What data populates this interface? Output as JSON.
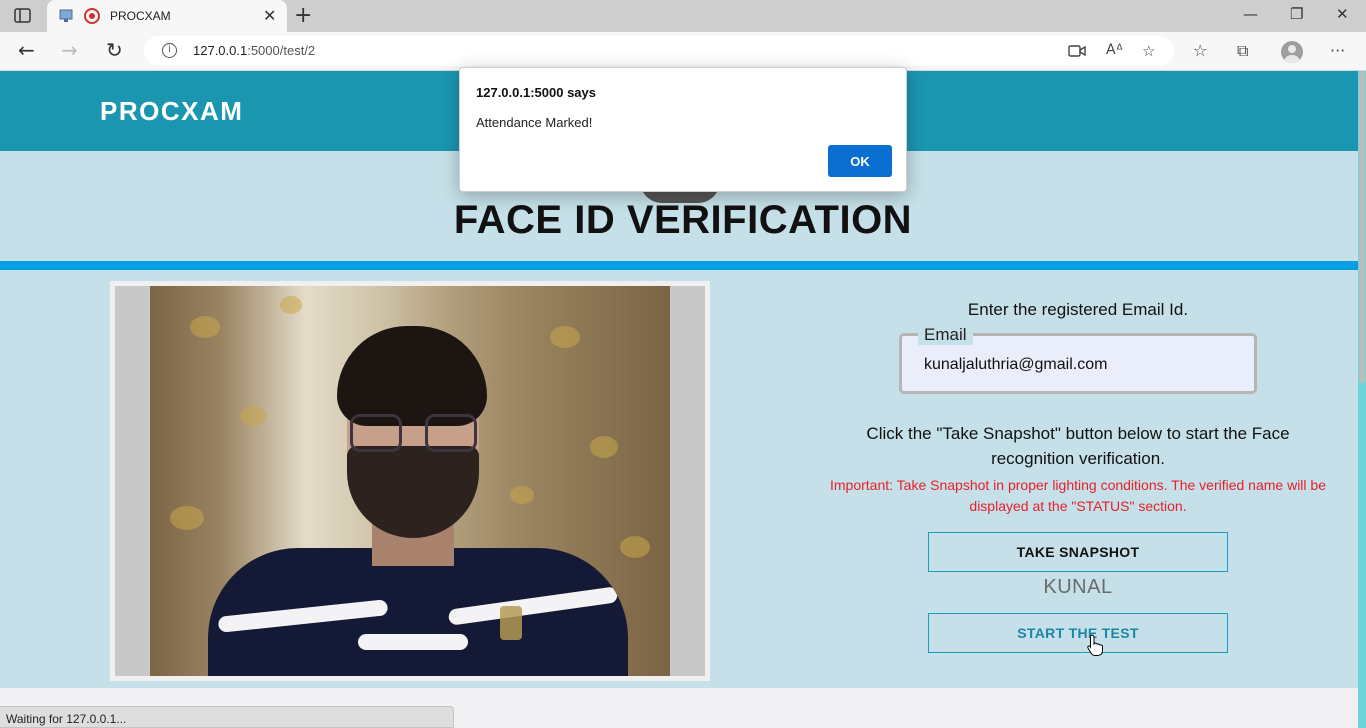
{
  "browser": {
    "tab_title": "PROCXAM",
    "url_host": "127.0.0.1",
    "url_path": ":5000/test/2",
    "status_text": "Waiting for 127.0.0.1..."
  },
  "site": {
    "brand": "PROCXAM",
    "page_title": "FACE ID VERIFICATION"
  },
  "form": {
    "instruction": "Enter the registered Email Id.",
    "email_legend": "Email",
    "email_value": "kunaljaluthria@gmail.com",
    "snapshot_info": "Click the \"Take Snapshot\" button below to start the Face recognition verification.",
    "important": "Important: Take Snapshot in proper lighting conditions. The verified name will be displayed at the \"STATUS\" section.",
    "snapshot_button": "TAKE SNAPSHOT",
    "status_name": "KUNAL",
    "start_button": "START THE TEST"
  },
  "dialog": {
    "title": "127.0.0.1:5000 says",
    "message": "Attendance Marked!",
    "ok_label": "OK"
  },
  "icons": {
    "tab_actions": "tab-actions-icon",
    "camera": "video-camera-icon",
    "read_aloud": "read-aloud-icon",
    "add_favorite": "add-favorite-icon",
    "favorites": "favorites-icon",
    "collections": "collections-icon",
    "profile": "profile-avatar-icon",
    "more": "more-options-icon"
  },
  "colors": {
    "header": "#1b96b1",
    "page_bg": "#c5e0e8",
    "divider": "#04a0e3",
    "warning": "#e8202a",
    "dialog_button": "#0a6fd0"
  }
}
